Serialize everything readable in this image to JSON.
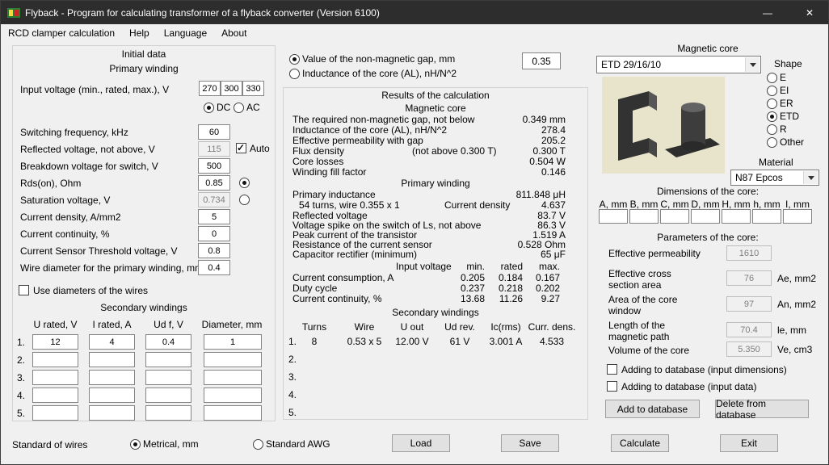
{
  "window": {
    "title": "Flyback - Program for calculating transformer of a flyback converter (Version 6100)",
    "minimize_glyph": "—",
    "close_glyph": "✕"
  },
  "menu": {
    "items": [
      "RCD clamper calculation",
      "Help",
      "Language",
      "About"
    ]
  },
  "initial": {
    "box_title": "Initial data",
    "primary_title": "Primary winding",
    "input_voltage": {
      "label": "Input voltage (min., rated, max.), V",
      "min": "270",
      "rated": "300",
      "max": "330"
    },
    "supply": {
      "dc": "DC",
      "ac": "AC",
      "selected": "DC"
    },
    "fields": [
      {
        "label": "Switching frequency, kHz",
        "value": "60"
      },
      {
        "label": "Reflected voltage, not above, V",
        "value": "115",
        "auto_label": "Auto"
      },
      {
        "label": "Breakdown voltage for switch, V",
        "value": "500"
      },
      {
        "label": "Rds(on), Ohm",
        "value": "0.85"
      },
      {
        "label": "Saturation voltage, V",
        "value": "0.734"
      },
      {
        "label": "Current density, A/mm2",
        "value": "5"
      },
      {
        "label": "Current continuity, %",
        "value": "0"
      },
      {
        "label": "Current Sensor Threshold voltage, V",
        "value": "0.8"
      },
      {
        "label": "Wire diameter for the primary winding, mm",
        "value": "0.4"
      }
    ],
    "use_diameters_label": "Use diameters of the wires",
    "secondary": {
      "title": "Secondary windings",
      "headers": [
        "U rated, V",
        "I rated, A",
        "Ud f, V",
        "Diameter, mm"
      ],
      "row_labels": [
        "1.",
        "2.",
        "3.",
        "4.",
        "5."
      ],
      "rows": [
        [
          "12",
          "4",
          "0.4",
          "1"
        ],
        [
          "",
          "",
          "",
          ""
        ],
        [
          "",
          "",
          "",
          ""
        ],
        [
          "",
          "",
          "",
          ""
        ],
        [
          "",
          "",
          "",
          ""
        ]
      ]
    }
  },
  "gap": {
    "option_gap": "Value of the non-magnetic gap, mm",
    "option_al": "Inductance of the core (AL), nH/N^2",
    "selected": "gap",
    "value": "0.35"
  },
  "results": {
    "box_title": "Results of the calculation",
    "magnetic": {
      "title": "Magnetic core",
      "rows": [
        {
          "label": "The required non-magnetic gap, not below",
          "value": "0.349 mm"
        },
        {
          "label": "Inductance of the core (AL), nH/N^2",
          "value": "278.4"
        },
        {
          "label": "Effective permeability with gap",
          "value": "205.2"
        },
        {
          "label": "Flux density",
          "mid": "(not above 0.300 T)",
          "value": "0.300 T"
        },
        {
          "label": "Core losses",
          "value": "0.504 W"
        },
        {
          "label": "Winding fill factor",
          "value": "0.146"
        }
      ]
    },
    "primary": {
      "title": "Primary winding",
      "rows": [
        {
          "label": "Primary inductance",
          "value": "811.848 μH"
        },
        {
          "label": "54 turns, wire 0.355 x 1",
          "mid": "Current density",
          "value": "4.637"
        },
        {
          "label": "Reflected voltage",
          "value": "83.7 V"
        },
        {
          "label": "Voltage spike on the switch of Ls, not above",
          "value": "86.3 V"
        },
        {
          "label": "Peak current of the transistor",
          "value": "1.519 A"
        },
        {
          "label": "Resistance of the current sensor",
          "value": "0.528 Ohm"
        },
        {
          "label": "Capacitor rectifier (minimum)",
          "value": "65 μF"
        }
      ]
    },
    "voltage_table": {
      "header_label": "Input voltage",
      "cols": [
        "min.",
        "rated",
        "max."
      ],
      "rows": [
        {
          "label": "Current consumption, A",
          "values": [
            "0.205",
            "0.184",
            "0.167"
          ]
        },
        {
          "label": "Duty cycle",
          "values": [
            "0.237",
            "0.218",
            "0.202"
          ]
        },
        {
          "label": "Current continuity, %",
          "values": [
            "13.68",
            "11.26",
            "9.27"
          ]
        }
      ]
    },
    "secondary": {
      "title": "Secondary windings",
      "headers": [
        "Turns",
        "Wire",
        "U out",
        "Ud rev.",
        "Ic(rms)",
        "Curr. dens."
      ],
      "row_labels": [
        "1.",
        "2.",
        "3.",
        "4.",
        "5."
      ],
      "rows": [
        [
          "8",
          "0.53 x 5",
          "12.00 V",
          "61 V",
          "3.001 A",
          "4.533"
        ],
        [
          "",
          "",
          "",
          "",
          "",
          ""
        ],
        [
          "",
          "",
          "",
          "",
          "",
          ""
        ],
        [
          "",
          "",
          "",
          "",
          "",
          ""
        ],
        [
          "",
          "",
          "",
          "",
          "",
          ""
        ]
      ]
    }
  },
  "core": {
    "title": "Magnetic core",
    "selected_core": "ETD 29/16/10",
    "shape": {
      "label": "Shape",
      "options": [
        "E",
        "EI",
        "ER",
        "ETD",
        "R",
        "Other"
      ],
      "selected": "ETD"
    },
    "material": {
      "label": "Material",
      "selected": "N87 Epcos"
    },
    "dimensions": {
      "title": "Dimensions of the core:",
      "labels": [
        "A, mm",
        "B, mm",
        "C, mm",
        "D, mm",
        "H, mm",
        "h, mm",
        "I, mm"
      ]
    },
    "parameters": {
      "title": "Parameters of the core:",
      "rows": [
        {
          "label": "Effective permeability",
          "value": "1610",
          "unit": ""
        },
        {
          "label": "Effective cross section area",
          "value": "76",
          "unit": "Ae, mm2"
        },
        {
          "label": "Area of the core window",
          "value": "97",
          "unit": "An, mm2"
        },
        {
          "label": "Length of the magnetic path",
          "value": "70.4",
          "unit": "le, mm"
        },
        {
          "label": "Volume of the core",
          "value": "5.350",
          "unit": "Ve, cm3"
        }
      ]
    },
    "db_checkbox_dimensions": "Adding to database (input dimensions)",
    "db_checkbox_data": "Adding to database (input data)",
    "add_button": "Add to database",
    "delete_button": "Delete from database"
  },
  "bottom": {
    "standard_label": "Standard of wires",
    "metric_label": "Metrical, mm",
    "awg_label": "Standard AWG",
    "load": "Load",
    "save": "Save",
    "calculate": "Calculate",
    "exit": "Exit"
  },
  "colors": {
    "titlebar": "#2d2d2d",
    "background": "#f0f0f0",
    "core_image_bg": "#e8e3cb"
  }
}
